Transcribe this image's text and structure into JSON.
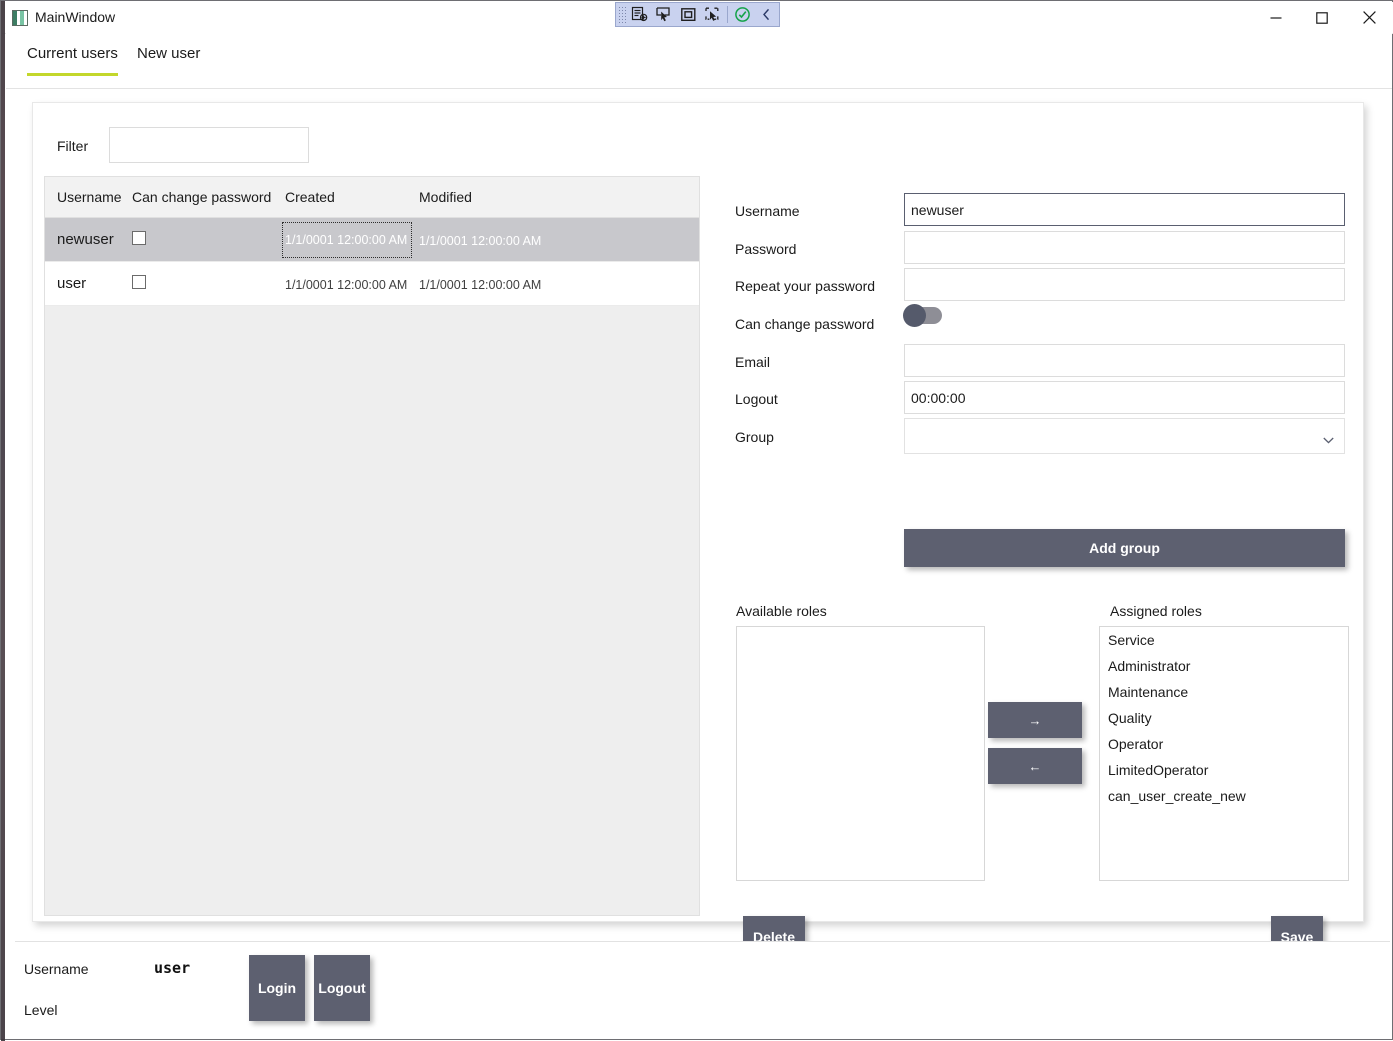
{
  "window": {
    "title": "MainWindow",
    "icon": "app-window-icon",
    "controls": {
      "minimize": "—",
      "maximize": "□",
      "close": "✕"
    }
  },
  "designer_overlay": {
    "tools": [
      "go-to-live-visual-tree-icon",
      "select-element-icon",
      "display-layout-adorner-icon",
      "track-focused-element-icon",
      "enabled-check-icon",
      "collapse-chevron-icon"
    ]
  },
  "tabs": {
    "items": [
      {
        "label": "Current users",
        "active": true
      },
      {
        "label": "New user",
        "active": false
      }
    ],
    "accent_color": "#c3d72b"
  },
  "filter": {
    "label": "Filter",
    "value": "",
    "placeholder": ""
  },
  "users_table": {
    "columns": [
      "Username",
      "Can change password",
      "Created",
      "Modified"
    ],
    "rows": [
      {
        "username": "newuser",
        "can_change_password": false,
        "created": "1/1/0001 12:00:00 AM",
        "modified": "1/1/0001 12:00:00 AM",
        "selected": true,
        "focused_cell": "created"
      },
      {
        "username": "user",
        "can_change_password": false,
        "created": "1/1/0001 12:00:00 AM",
        "modified": "1/1/0001 12:00:00 AM",
        "selected": false,
        "focused_cell": ""
      }
    ]
  },
  "form": {
    "username": {
      "label": "Username",
      "value": "newuser",
      "placeholder": ""
    },
    "password": {
      "label": "Password",
      "value": "",
      "placeholder": ""
    },
    "repeat_password": {
      "label": "Repeat your password",
      "value": "",
      "placeholder": ""
    },
    "can_change_password": {
      "label": "Can change password",
      "value": false
    },
    "email": {
      "label": "Email",
      "value": "",
      "placeholder": ""
    },
    "logout": {
      "label": "Logout",
      "value": "00:00:00",
      "placeholder": ""
    },
    "group": {
      "label": "Group",
      "value": "",
      "chevron": "chevron-down-icon"
    },
    "add_group_label": "Add group"
  },
  "roles": {
    "available_title": "Available roles",
    "assigned_title": "Assigned roles",
    "available": [],
    "assigned": [
      "Service",
      "Administrator",
      "Maintenance",
      "Quality",
      "Operator",
      "LimitedOperator",
      "can_user_create_new"
    ],
    "assign_button": "→",
    "unassign_button": "←"
  },
  "actions": {
    "delete_label": "Delete",
    "save_label": "Save"
  },
  "statusbar": {
    "username_label": "Username",
    "username_value": "user",
    "level_label": "Level",
    "level_value": "",
    "login_label": "Login",
    "logout_label": "Logout"
  },
  "colors": {
    "accent": "#c3d72b",
    "button": "#5d6070",
    "selection": "#c8c8cc"
  }
}
